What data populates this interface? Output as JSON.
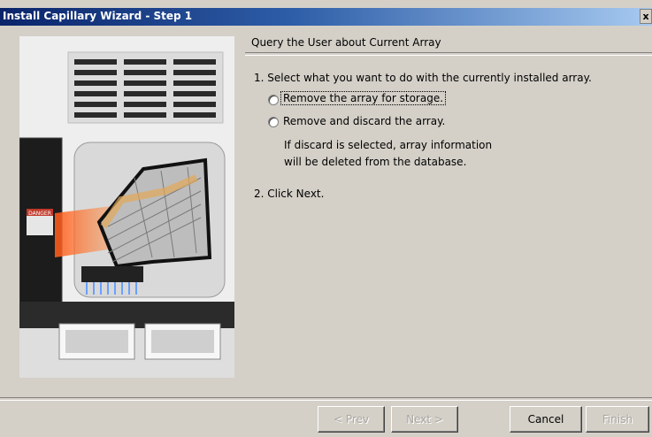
{
  "window": {
    "title": "Install Capillary Wizard - Step 1",
    "close_label": "x"
  },
  "content": {
    "header": "Query the User about Current Array",
    "step1": "1. Select what you want to do with the currently installed array.",
    "options": [
      {
        "label": "Remove the array for storage.",
        "selected": false,
        "focused": true
      },
      {
        "label": "Remove and discard the array.",
        "selected": false,
        "focused": false
      }
    ],
    "note_line1": "If discard is selected, array information",
    "note_line2": "will be deleted from the database.",
    "step2": "2. Click Next."
  },
  "image": {
    "warning_label": "DANGER"
  },
  "buttons": {
    "prev": "< Prev",
    "next": "Next >",
    "cancel": "Cancel",
    "finish": "Finish"
  }
}
